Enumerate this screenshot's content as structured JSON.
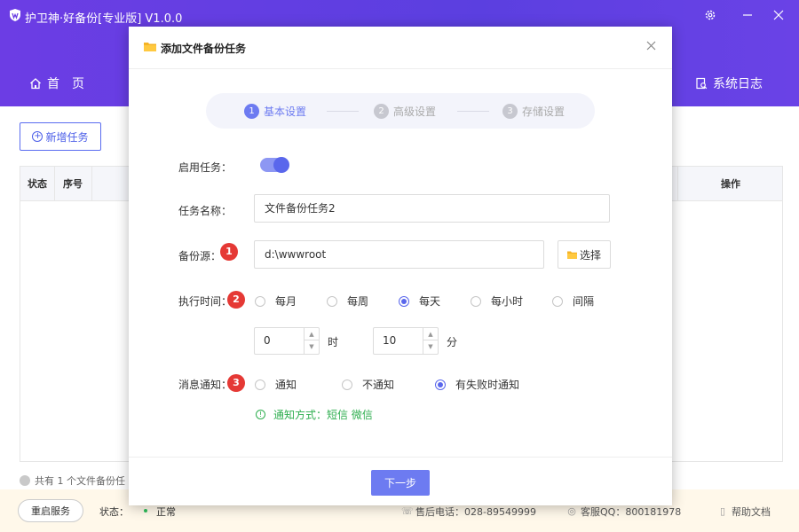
{
  "app": {
    "title": "护卫神·好备份[专业版]  V1.0.0",
    "nav_home": "首页",
    "nav_log": "系统日志"
  },
  "main": {
    "add_task": "新增任务",
    "table_headers": [
      "状态",
      "序号",
      "操作"
    ],
    "task_count": "共有 1 个文件备份任"
  },
  "status_bar": {
    "restart": "重启服务",
    "status_label": "状态：",
    "status_value": "正常",
    "phone": "售后电话：028-89549999",
    "qq": "客服QQ：800181978",
    "help": "帮助文档"
  },
  "dialog": {
    "title": "添加文件备份任务",
    "steps": [
      {
        "num": "1",
        "label": "基本设置",
        "active": true
      },
      {
        "num": "2",
        "label": "高级设置",
        "active": false
      },
      {
        "num": "3",
        "label": "存储设置",
        "active": false
      }
    ],
    "enable_label": "启用任务：",
    "enabled": true,
    "name_label": "任务名称：",
    "name_value": "文件备份任务2",
    "source_label": "备份源：",
    "source_value": "d:\\wwwroot",
    "select_button": "选择",
    "time_label": "执行时间：",
    "time_options": [
      "每月",
      "每周",
      "每天",
      "每小时",
      "间隔"
    ],
    "time_selected": "每天",
    "hour_value": "0",
    "hour_unit": "时",
    "minute_value": "10",
    "minute_unit": "分",
    "notify_label": "消息通知：",
    "notify_options": [
      "通知",
      "不通知",
      "有失败时通知"
    ],
    "notify_selected": "有失败时通知",
    "notify_hint": "通知方式：短信 微信",
    "badges": [
      "1",
      "2",
      "3"
    ],
    "next_button": "下一步"
  },
  "colors": {
    "header": "#6b3ee3",
    "accent": "#6d7bf1",
    "badge": "#e53935",
    "hint": "#2eae4f",
    "status_bar": "#fff8ea"
  }
}
